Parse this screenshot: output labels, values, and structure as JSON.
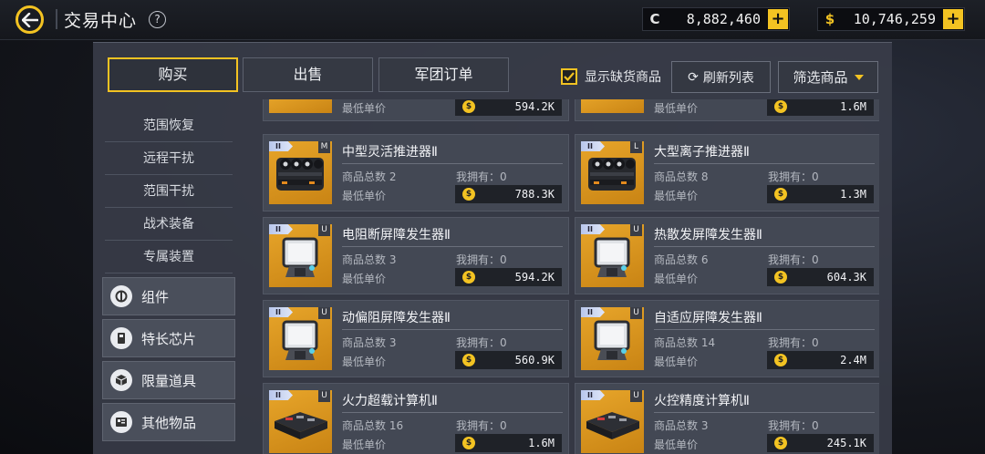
{
  "header": {
    "title": "交易中心",
    "help_label": "?",
    "currencies": [
      {
        "icon": "credit-icon",
        "symbol": "C",
        "value": "8,882,460",
        "plus": "+"
      },
      {
        "icon": "coin-icon",
        "symbol": "$",
        "value": "10,746,259",
        "plus": "+"
      }
    ]
  },
  "tabs": [
    {
      "label": "购买",
      "active": true
    },
    {
      "label": "出售",
      "active": false
    },
    {
      "label": "军团订单",
      "active": false
    }
  ],
  "toolbar": {
    "show_missing_label": "显示缺货商品",
    "show_missing_checked": true,
    "refresh_label": "刷新列表",
    "filter_label": "筛选商品"
  },
  "sidebar": {
    "sub_items": [
      "范围恢复",
      "远程干扰",
      "范围干扰",
      "战术装备",
      "专属装置"
    ],
    "categories": [
      {
        "label": "组件",
        "icon": "component-icon"
      },
      {
        "label": "特长芯片",
        "icon": "chip-icon"
      },
      {
        "label": "限量道具",
        "icon": "box-icon"
      },
      {
        "label": "其他物品",
        "icon": "misc-icon"
      }
    ]
  },
  "labels": {
    "total_prefix": "商品总数",
    "owned_prefix": "我拥有：",
    "lowest_price": "最低单价",
    "coin_symbol": "$"
  },
  "partial_row": [
    {
      "price": "594.2K"
    },
    {
      "price": "1.6M"
    }
  ],
  "items": [
    {
      "name": "中型灵活推进器Ⅱ",
      "tier": "II",
      "size": "M",
      "total": "2",
      "owned": "0",
      "price": "788.3K",
      "kind": "thruster"
    },
    {
      "name": "大型离子推进器Ⅱ",
      "tier": "II",
      "size": "L",
      "total": "8",
      "owned": "0",
      "price": "1.3M",
      "kind": "thruster"
    },
    {
      "name": "电阻断屏障发生器Ⅱ",
      "tier": "II",
      "size": "U",
      "total": "3",
      "owned": "0",
      "price": "594.2K",
      "kind": "shield"
    },
    {
      "name": "热散发屏障发生器Ⅱ",
      "tier": "II",
      "size": "U",
      "total": "6",
      "owned": "0",
      "price": "604.3K",
      "kind": "shield"
    },
    {
      "name": "动偏阻屏障发生器Ⅱ",
      "tier": "II",
      "size": "U",
      "total": "3",
      "owned": "0",
      "price": "560.9K",
      "kind": "shield"
    },
    {
      "name": "自适应屏障发生器Ⅱ",
      "tier": "II",
      "size": "U",
      "total": "14",
      "owned": "0",
      "price": "2.4M",
      "kind": "shield"
    },
    {
      "name": "火力超载计算机Ⅱ",
      "tier": "II",
      "size": "U",
      "total": "16",
      "owned": "0",
      "price": "1.6M",
      "kind": "computer"
    },
    {
      "name": "火控精度计算机Ⅱ",
      "tier": "II",
      "size": "U",
      "total": "3",
      "owned": "0",
      "price": "245.1K",
      "kind": "computer"
    }
  ]
}
